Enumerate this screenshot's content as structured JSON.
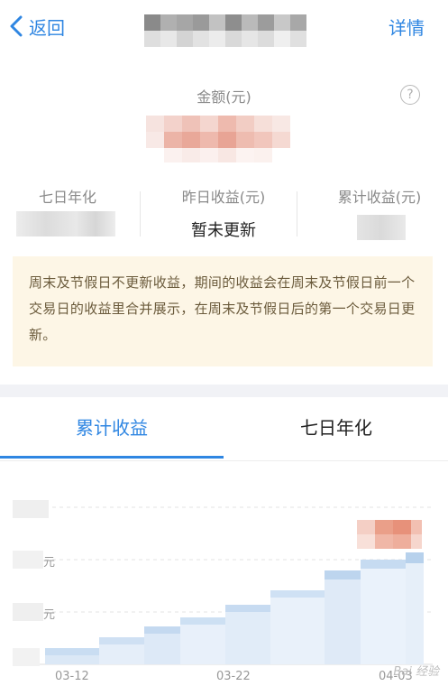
{
  "nav": {
    "back_label": "返回",
    "detail_label": "详情"
  },
  "amount": {
    "label": "金额(元)",
    "help_glyph": "?"
  },
  "stats": [
    {
      "label": "七日年化",
      "value": ""
    },
    {
      "label": "昨日收益(元)",
      "value": "暂未更新"
    },
    {
      "label": "累计收益(元)",
      "value": ""
    }
  ],
  "notice": "周末及节假日不更新收益，期间的收益会在周末及节假日前一个交易日的收益里合并展示，在周末及节假日后的第一个交易日更新。",
  "tabs": [
    {
      "label": "累计收益",
      "active": true
    },
    {
      "label": "七日年化",
      "active": false
    }
  ],
  "chart": {
    "y_labels": [
      "元",
      "元"
    ],
    "x_labels": [
      "03-12",
      "03-22",
      "04-03"
    ]
  },
  "watermark": "Bai 经验",
  "colors": {
    "accent": "#2f86e2",
    "notice_bg": "#fdf6e6",
    "notice_text": "#6b5b3c"
  }
}
